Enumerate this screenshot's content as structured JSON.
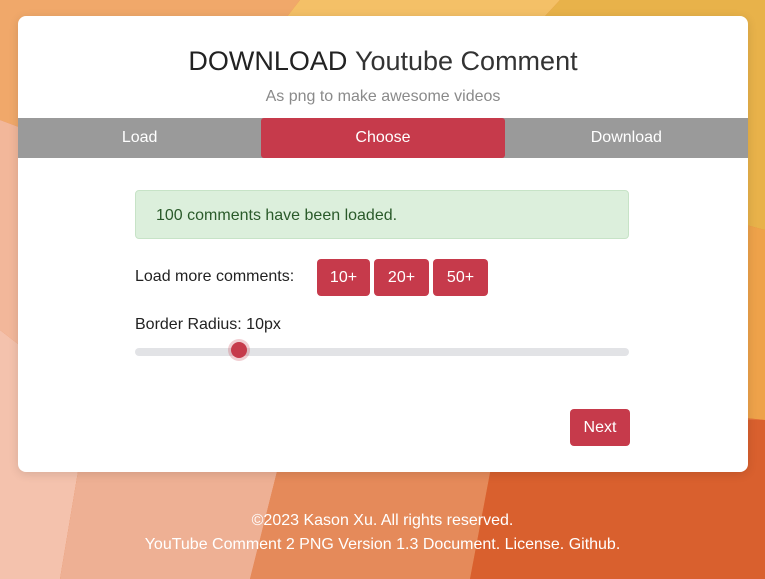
{
  "header": {
    "title_bold": "DOWNLOAD",
    "title_light": "Youtube Comment",
    "subtitle": "As png to make awesome videos"
  },
  "steps": [
    {
      "label": "Load",
      "active": false
    },
    {
      "label": "Choose",
      "active": true
    },
    {
      "label": "Download",
      "active": false
    }
  ],
  "alert": {
    "message": "100 comments have been loaded."
  },
  "load_more": {
    "label": "Load more comments:",
    "buttons": [
      "10+",
      "20+",
      "50+"
    ]
  },
  "border_radius": {
    "label": "Border Radius: 10px",
    "fraction": 0.21
  },
  "next_label": "Next",
  "footer": {
    "copyright": "©2023 Kason Xu. All rights reserved.",
    "version_text": "YouTube Comment 2 PNG Version 1.3",
    "links": [
      "Document.",
      "License.",
      "Github."
    ]
  },
  "colors": {
    "accent": "#c63a4b",
    "steps_bar": "#9a9a9a",
    "alert_bg": "#dcefdc"
  }
}
